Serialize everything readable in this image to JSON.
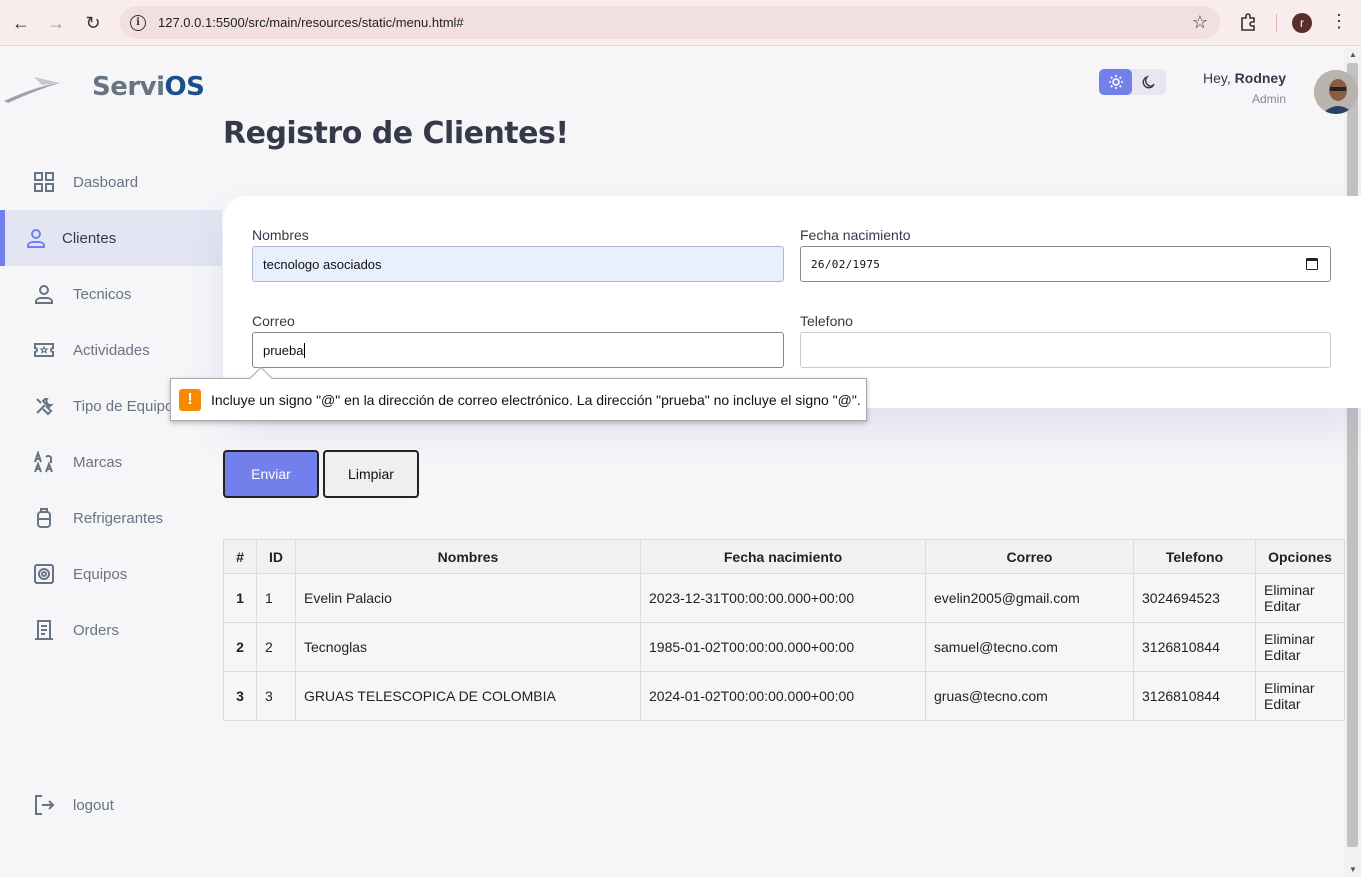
{
  "browser": {
    "url": "127.0.0.1:5500/src/main/resources/static/menu.html#",
    "profile_initial": "r"
  },
  "brand": {
    "name_part1": "Servi",
    "name_part2": "OS"
  },
  "sidebar": {
    "items": [
      {
        "label": "Dasboard",
        "icon": "grid-icon",
        "active": false
      },
      {
        "label": "Clientes",
        "icon": "person-icon",
        "active": true
      },
      {
        "label": "Tecnicos",
        "icon": "person-icon",
        "active": false
      },
      {
        "label": "Actividades",
        "icon": "ticket-icon",
        "active": false
      },
      {
        "label": "Tipo de Equipo",
        "icon": "tools-icon",
        "active": false
      },
      {
        "label": "Marcas",
        "icon": "translate-icon",
        "active": false
      },
      {
        "label": "Refrigerantes",
        "icon": "tank-icon",
        "active": false
      },
      {
        "label": "Equipos",
        "icon": "device-icon",
        "active": false
      },
      {
        "label": "Orders",
        "icon": "receipt-icon",
        "active": false
      }
    ],
    "logout_label": "logout"
  },
  "header": {
    "greeting": "Hey, ",
    "user_name": "Rodney",
    "role": "Admin",
    "theme": "light"
  },
  "page": {
    "title": "Registro de Clientes!"
  },
  "form": {
    "nombres_label": "Nombres",
    "nombres_value": "tecnologo asociados",
    "fecha_label": "Fecha nacimiento",
    "fecha_value": "26/02/1975",
    "correo_label": "Correo",
    "correo_value": "prueba",
    "telefono_label": "Telefono",
    "telefono_value": "",
    "validation_message": "Incluye un signo \"@\" en la dirección de correo electrónico. La dirección \"prueba\" no incluye el signo \"@\".",
    "submit_label": "Enviar",
    "clear_label": "Limpiar"
  },
  "table": {
    "headers": [
      "#",
      "ID",
      "Nombres",
      "Fecha nacimiento",
      "Correo",
      "Telefono",
      "Opciones"
    ],
    "rows": [
      {
        "n": "1",
        "id": "1",
        "nombres": "Evelin Palacio",
        "fecha": "2023-12-31T00:00:00.000+00:00",
        "correo": "evelin2005@gmail.com",
        "telefono": "3024694523",
        "eliminar": "Eliminar",
        "editar": "Editar"
      },
      {
        "n": "2",
        "id": "2",
        "nombres": "Tecnoglas",
        "fecha": "1985-01-02T00:00:00.000+00:00",
        "correo": "samuel@tecno.com",
        "telefono": "3126810844",
        "eliminar": "Eliminar",
        "editar": "Editar"
      },
      {
        "n": "3",
        "id": "3",
        "nombres": "GRUAS TELESCOPICA DE COLOMBIA",
        "fecha": "2024-01-02T00:00:00.000+00:00",
        "correo": "gruas@tecno.com",
        "telefono": "3126810844",
        "eliminar": "Eliminar",
        "editar": "Editar"
      }
    ]
  },
  "colors": {
    "primary": "#7380ec",
    "warning": "#f88a00",
    "background": "#f6f6f9"
  }
}
